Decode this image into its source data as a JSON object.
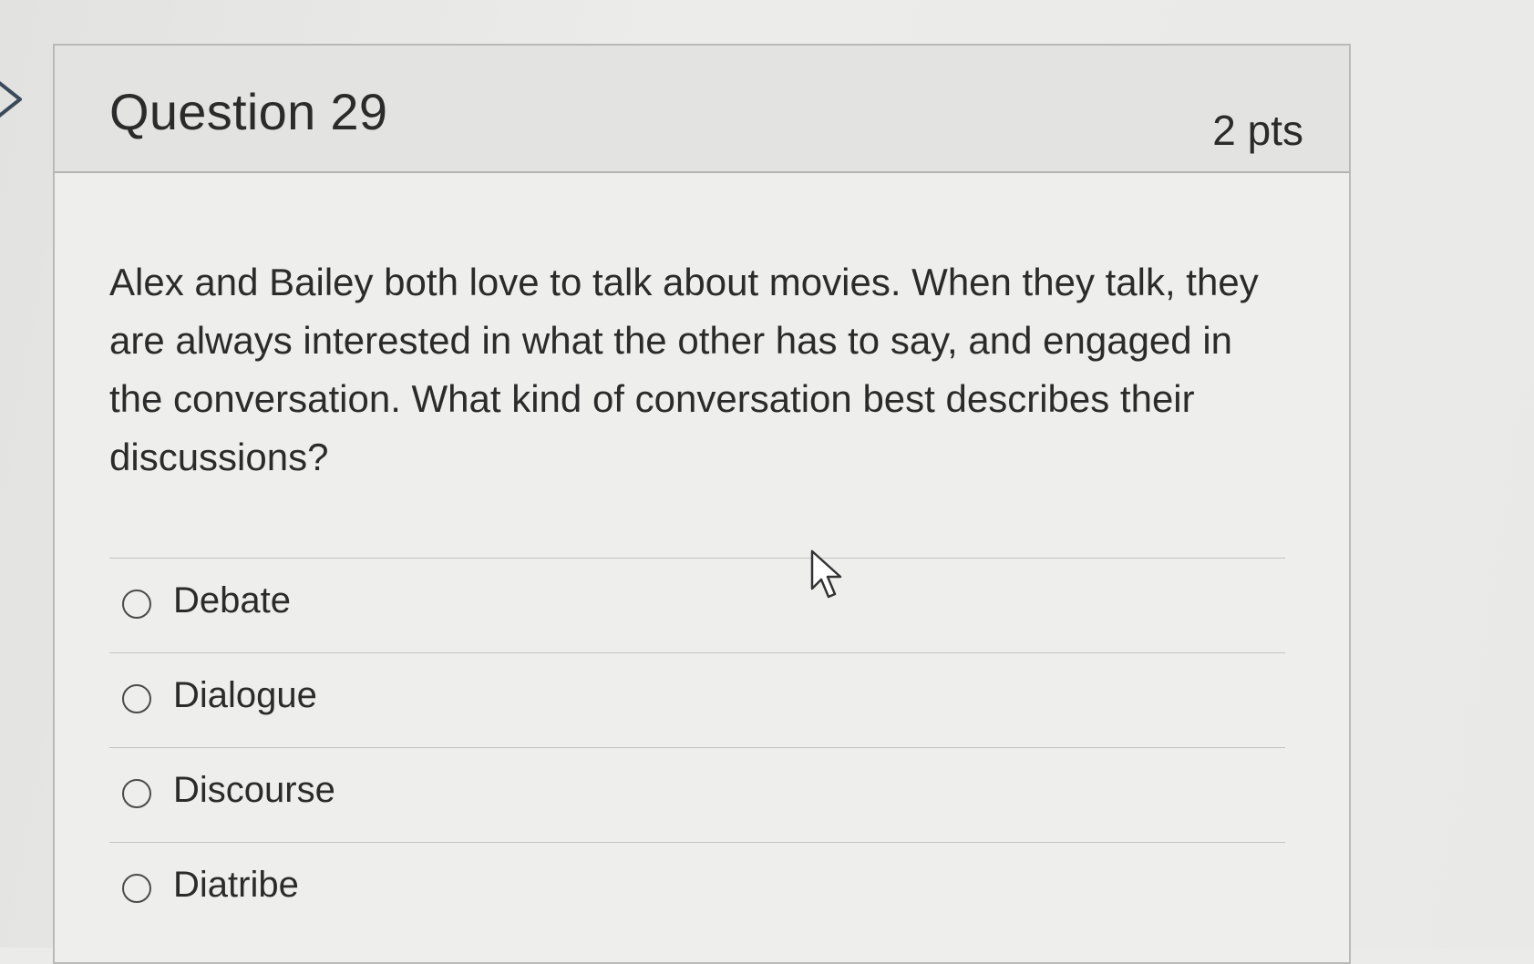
{
  "question": {
    "title": "Question 29",
    "points": "2 pts",
    "text": "Alex and Bailey both love to talk about movies. When they talk, they are always interested in what the other has to say, and engaged in the conversation. What kind of conversation best describes their discussions?"
  },
  "answers": [
    {
      "label": "Debate",
      "selected": false
    },
    {
      "label": "Dialogue",
      "selected": false
    },
    {
      "label": "Discourse",
      "selected": false
    },
    {
      "label": "Diatribe",
      "selected": false
    }
  ],
  "icons": {
    "nav": "chevron-right-icon",
    "pointer": "mouse-cursor-icon",
    "radio": "radio-button-icon"
  },
  "colors": {
    "text": "#2b2b2b",
    "header_bg": "#e3e3e1",
    "card_bg": "#eeeeec",
    "border": "#b9b9b7"
  }
}
